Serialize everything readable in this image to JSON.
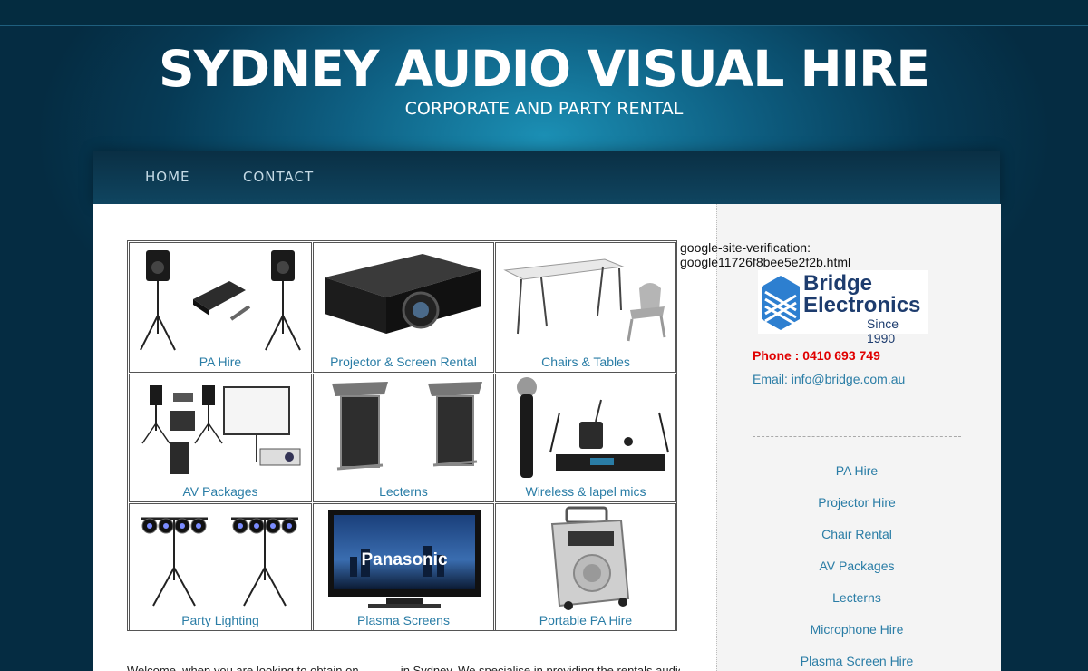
{
  "header": {
    "title": "SYDNEY AUDIO VISUAL HIRE",
    "subtitle": "CORPORATE AND PARTY RENTAL"
  },
  "nav": {
    "items": [
      {
        "label": "HOME"
      },
      {
        "label": "CONTACT"
      }
    ]
  },
  "products": [
    {
      "label": "PA Hire",
      "icon": "pa-speakers-icon"
    },
    {
      "label": "Projector & Screen Rental",
      "icon": "projector-icon"
    },
    {
      "label": "Chairs & Tables",
      "icon": "table-chair-icon"
    },
    {
      "label": "AV Packages",
      "icon": "av-package-icon"
    },
    {
      "label": "Lecterns",
      "icon": "lectern-icon"
    },
    {
      "label": "Wireless & lapel mics",
      "icon": "wireless-mic-icon"
    },
    {
      "label": "Party Lighting",
      "icon": "party-lights-icon"
    },
    {
      "label": "Plasma Screens",
      "icon": "plasma-screen-icon"
    },
    {
      "label": "Portable PA Hire",
      "icon": "portable-pa-icon"
    }
  ],
  "plasma_brand": "Panasonic",
  "sidebar": {
    "verification_line1": "google-site-verification:",
    "verification_line2": "google11726f8bee5e2f2b.html",
    "logo": {
      "line1": "Bridge",
      "line2": "Electronics",
      "line3": "Since 1990",
      "color": "#1d3c6e",
      "accent": "#2d7fd0"
    },
    "phone": "Phone : 0410 693 749",
    "email": "Email: info@bridge.com.au",
    "links": [
      {
        "label": "PA Hire"
      },
      {
        "label": "Projector Hire"
      },
      {
        "label": "Chair Rental"
      },
      {
        "label": "AV Packages"
      },
      {
        "label": "Lecterns"
      },
      {
        "label": "Microphone Hire"
      },
      {
        "label": "Plasma Screen Hire"
      }
    ]
  },
  "main": {
    "welcome_text": "Welcome, when you are looking to obtain on ……… in Sydney. We specialise in providing the rentals audio"
  },
  "colors": {
    "link": "#2a7da6",
    "phone": "#e00000",
    "background": "#0e5f82"
  }
}
